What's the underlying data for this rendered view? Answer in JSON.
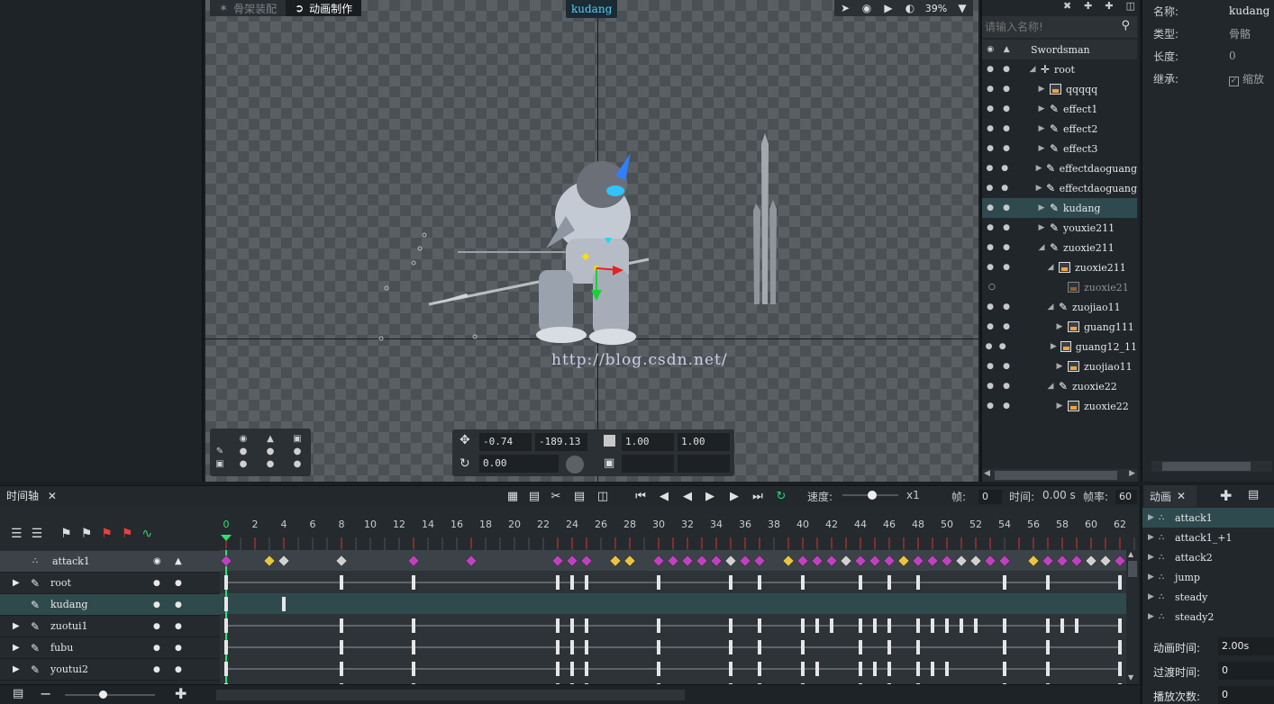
{
  "mode_tabs": [
    {
      "label": "骨架装配"
    },
    {
      "label": "动画制作"
    }
  ],
  "selected_bone": "kudang",
  "zoom": "39%",
  "watermark": "http://blog.csdn.net/",
  "transform": {
    "pos_x": "-0.74",
    "pos_y": "-189.13",
    "scale_x": "1.00",
    "scale_y": "1.00",
    "rotation": "0.00"
  },
  "hierarchy": {
    "search_placeholder": "请输入名称!",
    "root_label": "Swordsman",
    "items": [
      {
        "label": "root",
        "indent": 0,
        "icon": "cross",
        "arrow": "down"
      },
      {
        "label": "qqqqq",
        "indent": 1,
        "icon": "image",
        "arrow": "right"
      },
      {
        "label": "effect1",
        "indent": 1,
        "icon": "bone",
        "arrow": "right"
      },
      {
        "label": "effect2",
        "indent": 1,
        "icon": "bone",
        "arrow": "right"
      },
      {
        "label": "effect3",
        "indent": 1,
        "icon": "bone",
        "arrow": "right"
      },
      {
        "label": "effectdaoguang",
        "indent": 1,
        "icon": "bone",
        "arrow": "right"
      },
      {
        "label": "effectdaoguang",
        "indent": 1,
        "icon": "bone",
        "arrow": "right"
      },
      {
        "label": "kudang",
        "indent": 1,
        "icon": "bone",
        "arrow": "right",
        "selected": true
      },
      {
        "label": "youxie211",
        "indent": 1,
        "icon": "bone",
        "arrow": "right"
      },
      {
        "label": "zuoxie211",
        "indent": 1,
        "icon": "bone",
        "arrow": "down"
      },
      {
        "label": "zuoxie211",
        "indent": 2,
        "icon": "image",
        "arrow": "down"
      },
      {
        "label": "zuoxie21",
        "indent": 3,
        "icon": "image-dim",
        "arrow": "none",
        "ring": true
      },
      {
        "label": "zuojiao11",
        "indent": 2,
        "icon": "bone",
        "arrow": "down"
      },
      {
        "label": "guang111",
        "indent": 3,
        "icon": "image",
        "arrow": "right"
      },
      {
        "label": "guang12_11",
        "indent": 3,
        "icon": "image",
        "arrow": "right"
      },
      {
        "label": "zuojiao11",
        "indent": 3,
        "icon": "image",
        "arrow": "right"
      },
      {
        "label": "zuoxie22",
        "indent": 2,
        "icon": "bone",
        "arrow": "down"
      },
      {
        "label": "zuoxie22",
        "indent": 3,
        "icon": "image",
        "arrow": "right"
      }
    ]
  },
  "properties": [
    {
      "label": "名称:",
      "value": "kudang"
    },
    {
      "label": "类型:",
      "value": "骨骼"
    },
    {
      "label": "长度:",
      "value": "0"
    },
    {
      "label": "继承:",
      "value": "缩放",
      "checkbox": true
    }
  ],
  "timeline": {
    "title": "时间轴",
    "speed_label": "速度:",
    "speed_value": "x1",
    "frame_label": "帧:",
    "frame_value": "0",
    "time_label": "时间:",
    "time_value": "0.00 s",
    "fps_label": "帧率:",
    "fps_value": "60",
    "ruler_labels": [
      "0",
      "2",
      "4",
      "6",
      "8",
      "10",
      "12",
      "14",
      "16",
      "18",
      "20",
      "22",
      "24",
      "26",
      "28",
      "30",
      "32",
      "34",
      "36",
      "38",
      "40",
      "42",
      "44",
      "46",
      "48",
      "50",
      "52",
      "54",
      "56",
      "58",
      "60",
      "62"
    ],
    "tracks": [
      {
        "name": "attack1",
        "kind": "animation"
      },
      {
        "name": "root",
        "kind": "bone",
        "expandable": true
      },
      {
        "name": "kudang",
        "kind": "bone",
        "selected": true
      },
      {
        "name": "zuotui1",
        "kind": "bone",
        "expandable": true
      },
      {
        "name": "fubu",
        "kind": "bone",
        "expandable": true
      },
      {
        "name": "youtui2",
        "kind": "bone",
        "expandable": true
      }
    ]
  },
  "animations": {
    "title": "动画",
    "items": [
      {
        "label": "attack1",
        "selected": true
      },
      {
        "label": "attack1_+1"
      },
      {
        "label": "attack2"
      },
      {
        "label": "jump"
      },
      {
        "label": "steady"
      },
      {
        "label": "steady2"
      }
    ],
    "props": [
      {
        "label": "动画时间:",
        "value": "2.00s"
      },
      {
        "label": "过渡时间:",
        "value": "0"
      },
      {
        "label": "播放次数:",
        "value": "0"
      }
    ]
  }
}
